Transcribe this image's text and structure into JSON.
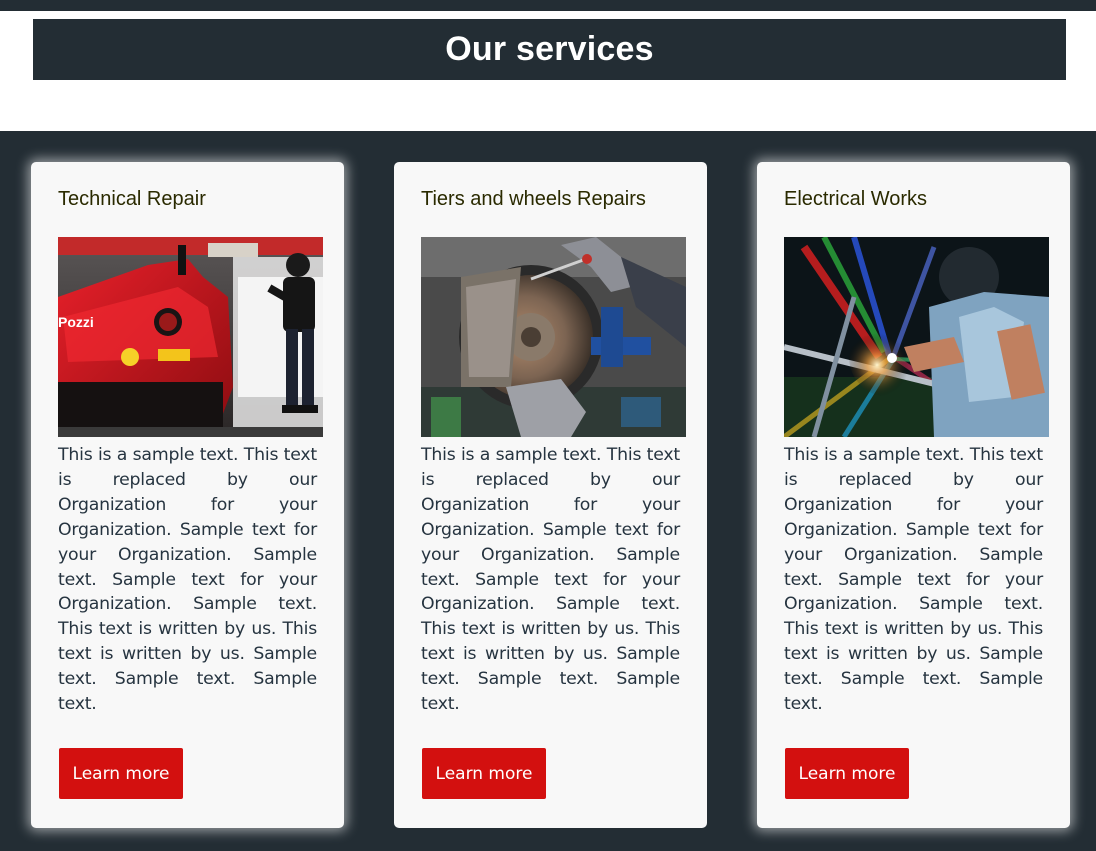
{
  "header": {
    "title": "Our services"
  },
  "colors": {
    "background": "#232d34",
    "card": "#f8f8f8",
    "button": "#d3100f",
    "title_text": "#ffffff"
  },
  "cards": [
    {
      "title": "Technical Repair",
      "image_icon": "race-car-repair-photo",
      "text": "This is a sample text. This text is replaced by our Organization for your Organization. Sample text for your Organization. Sample text. Sample text for your Organization. Sample text. This text is written by us. This text is written by us. Sample text. Sample text. Sample text.",
      "button": "Learn more"
    },
    {
      "title": "Tiers and wheels Repairs",
      "image_icon": "brake-disc-repair-photo",
      "text": "This is a sample text. This text is replaced by our Organization for your Organization. Sample text for your Organization. Sample text. Sample text for your Organization. Sample text. This text is written by us. This text is written by us. Sample text. Sample text. Sample text.",
      "button": "Learn more"
    },
    {
      "title": "Electrical Works",
      "image_icon": "welding-work-photo",
      "text": "This is a sample text. This text is replaced by our Organization for your Organization. Sample text for your Organization. Sample text. Sample text for your Organization. Sample text. This text is written by us. This text is written by us. Sample text. Sample text. Sample text.",
      "button": "Learn more"
    }
  ]
}
